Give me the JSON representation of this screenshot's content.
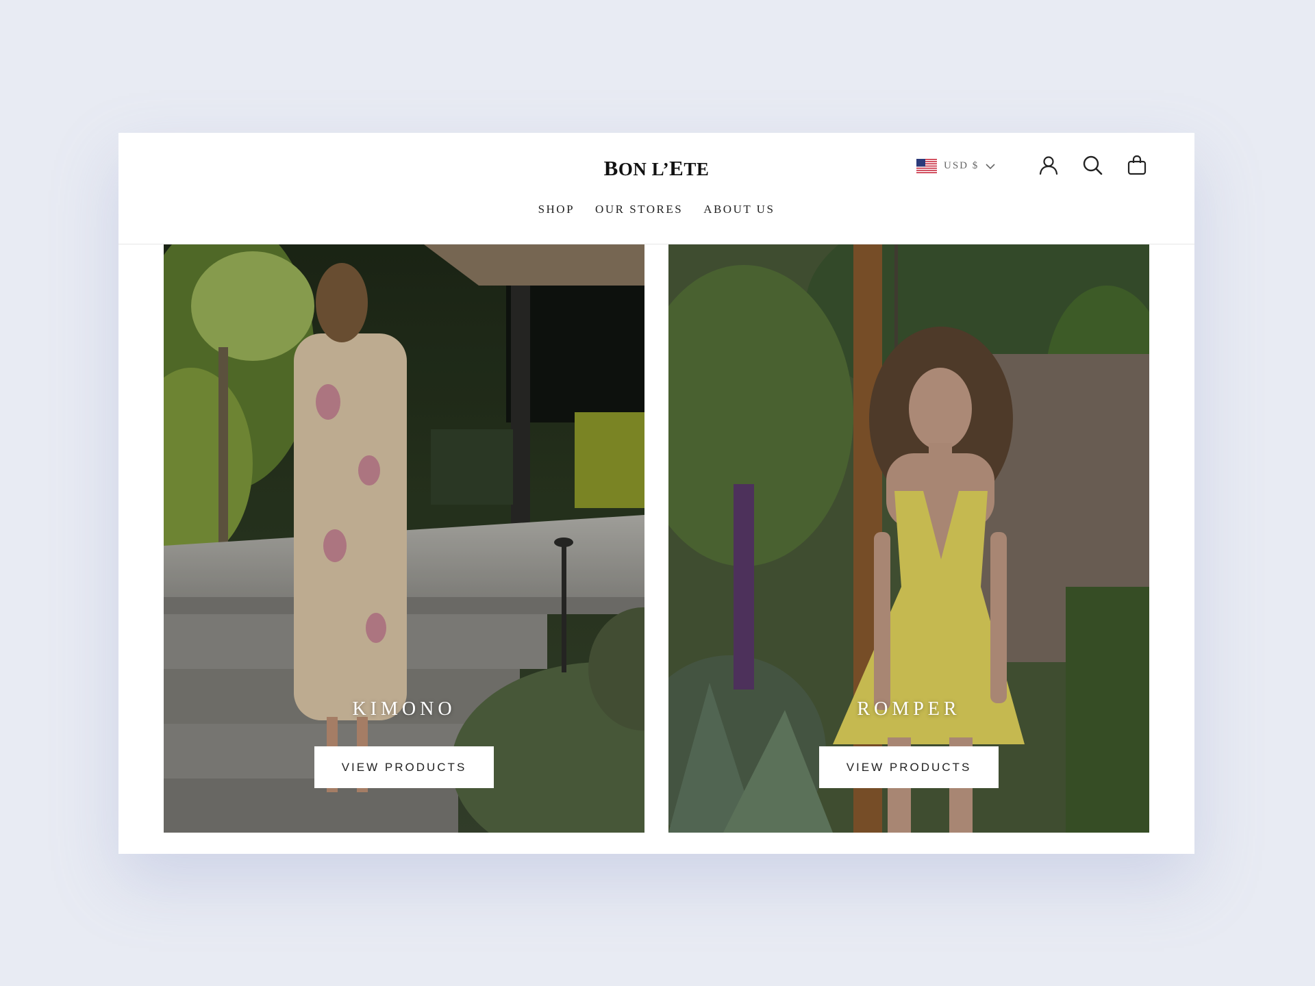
{
  "brand": {
    "logo_first": "B",
    "logo_mid": "ON L’",
    "logo_e": "E",
    "logo_rest": "TE"
  },
  "nav": {
    "items": [
      "SHOP",
      "OUR STORES",
      "ABOUT US"
    ]
  },
  "header": {
    "currency_label": "USD $",
    "icons": [
      "account-icon",
      "search-icon",
      "cart-icon"
    ]
  },
  "collections": [
    {
      "title": "KIMONO",
      "button_label": "VIEW PRODUCTS"
    },
    {
      "title": "ROMPER",
      "button_label": "VIEW PRODUCTS"
    }
  ],
  "colors": {
    "background": "#e8ebf3",
    "surface": "#ffffff",
    "text": "#222222"
  }
}
